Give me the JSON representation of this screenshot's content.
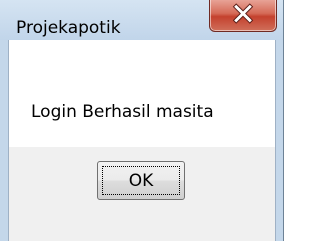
{
  "window": {
    "title": "Projekapotik",
    "message": "Login Berhasil masita",
    "close_icon": "close-icon"
  },
  "buttons": {
    "ok_label": "OK"
  },
  "colors": {
    "titlebar": "#c4d7ea",
    "close_button": "#c4412e",
    "client_background": "#ffffff",
    "button_area": "#f0f0f0"
  }
}
